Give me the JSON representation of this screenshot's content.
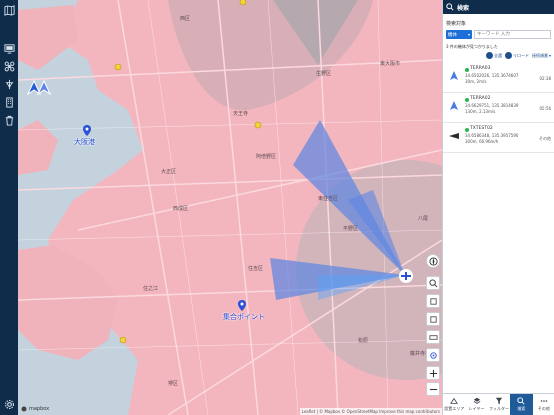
{
  "panel": {
    "title": "検索",
    "section_title": "検索対象",
    "search": {
      "category": "機体",
      "placeholder": "キーワード 入力"
    },
    "results_text": "3 件の機体が見つかりました",
    "actions": {
      "all": "全選",
      "reload": "リロード",
      "sort": "接続順番"
    },
    "items": [
      {
        "name": "TERRA03",
        "coords": "34.6502026, 135.3674607",
        "meta": "30m, 2m/s",
        "time": "02:38",
        "status_color": "#2ab44b"
      },
      {
        "name": "TERRA02",
        "coords": "34.6629751, 135.3814839",
        "meta": "130m, 2.13m/s",
        "time": "05:56",
        "status_color": "#2ab44b"
      },
      {
        "name": "TXTEST02",
        "coords": "34.6586348, 135.3957590",
        "meta": "300m, 60.96m/h",
        "time": "その他",
        "status_color": "#2ab44b"
      }
    ],
    "tabs": [
      {
        "label": "設置エリア",
        "icon": "area-icon"
      },
      {
        "label": "レイヤー",
        "icon": "layers-icon"
      },
      {
        "label": "フィルター",
        "icon": "filter-icon"
      },
      {
        "label": "検索",
        "icon": "search-icon"
      },
      {
        "label": "その他",
        "icon": "more-icon"
      }
    ]
  },
  "map": {
    "labels": {
      "nishi": "西区",
      "suehiro": "東大阪市",
      "sanoku": "生野区",
      "abeno": "阿倍野区",
      "taisho": "大正区",
      "nishinari": "西成区",
      "sumiyoshi": "住吉区",
      "hirano": "平野区",
      "yao": "八尾",
      "matsubara": "松原",
      "fujiidera": "藤井寺市",
      "suminoe": "住之江",
      "sakai": "堺区",
      "tennoji": "天王寺",
      "higashi": "東住吉区"
    },
    "poi": {
      "port": "大阪港",
      "meeting": "集合ポイント"
    },
    "attribution": "Leaflet | © Mapbox © OpenStreetMap Improve this map contributors",
    "logo": "mapbox"
  },
  "colors": {
    "nav": "#0f2d4a",
    "accent": "#1d6fd8",
    "restricted_zone": "#f2a5b0",
    "flight_sector": "#4f7fe0"
  }
}
